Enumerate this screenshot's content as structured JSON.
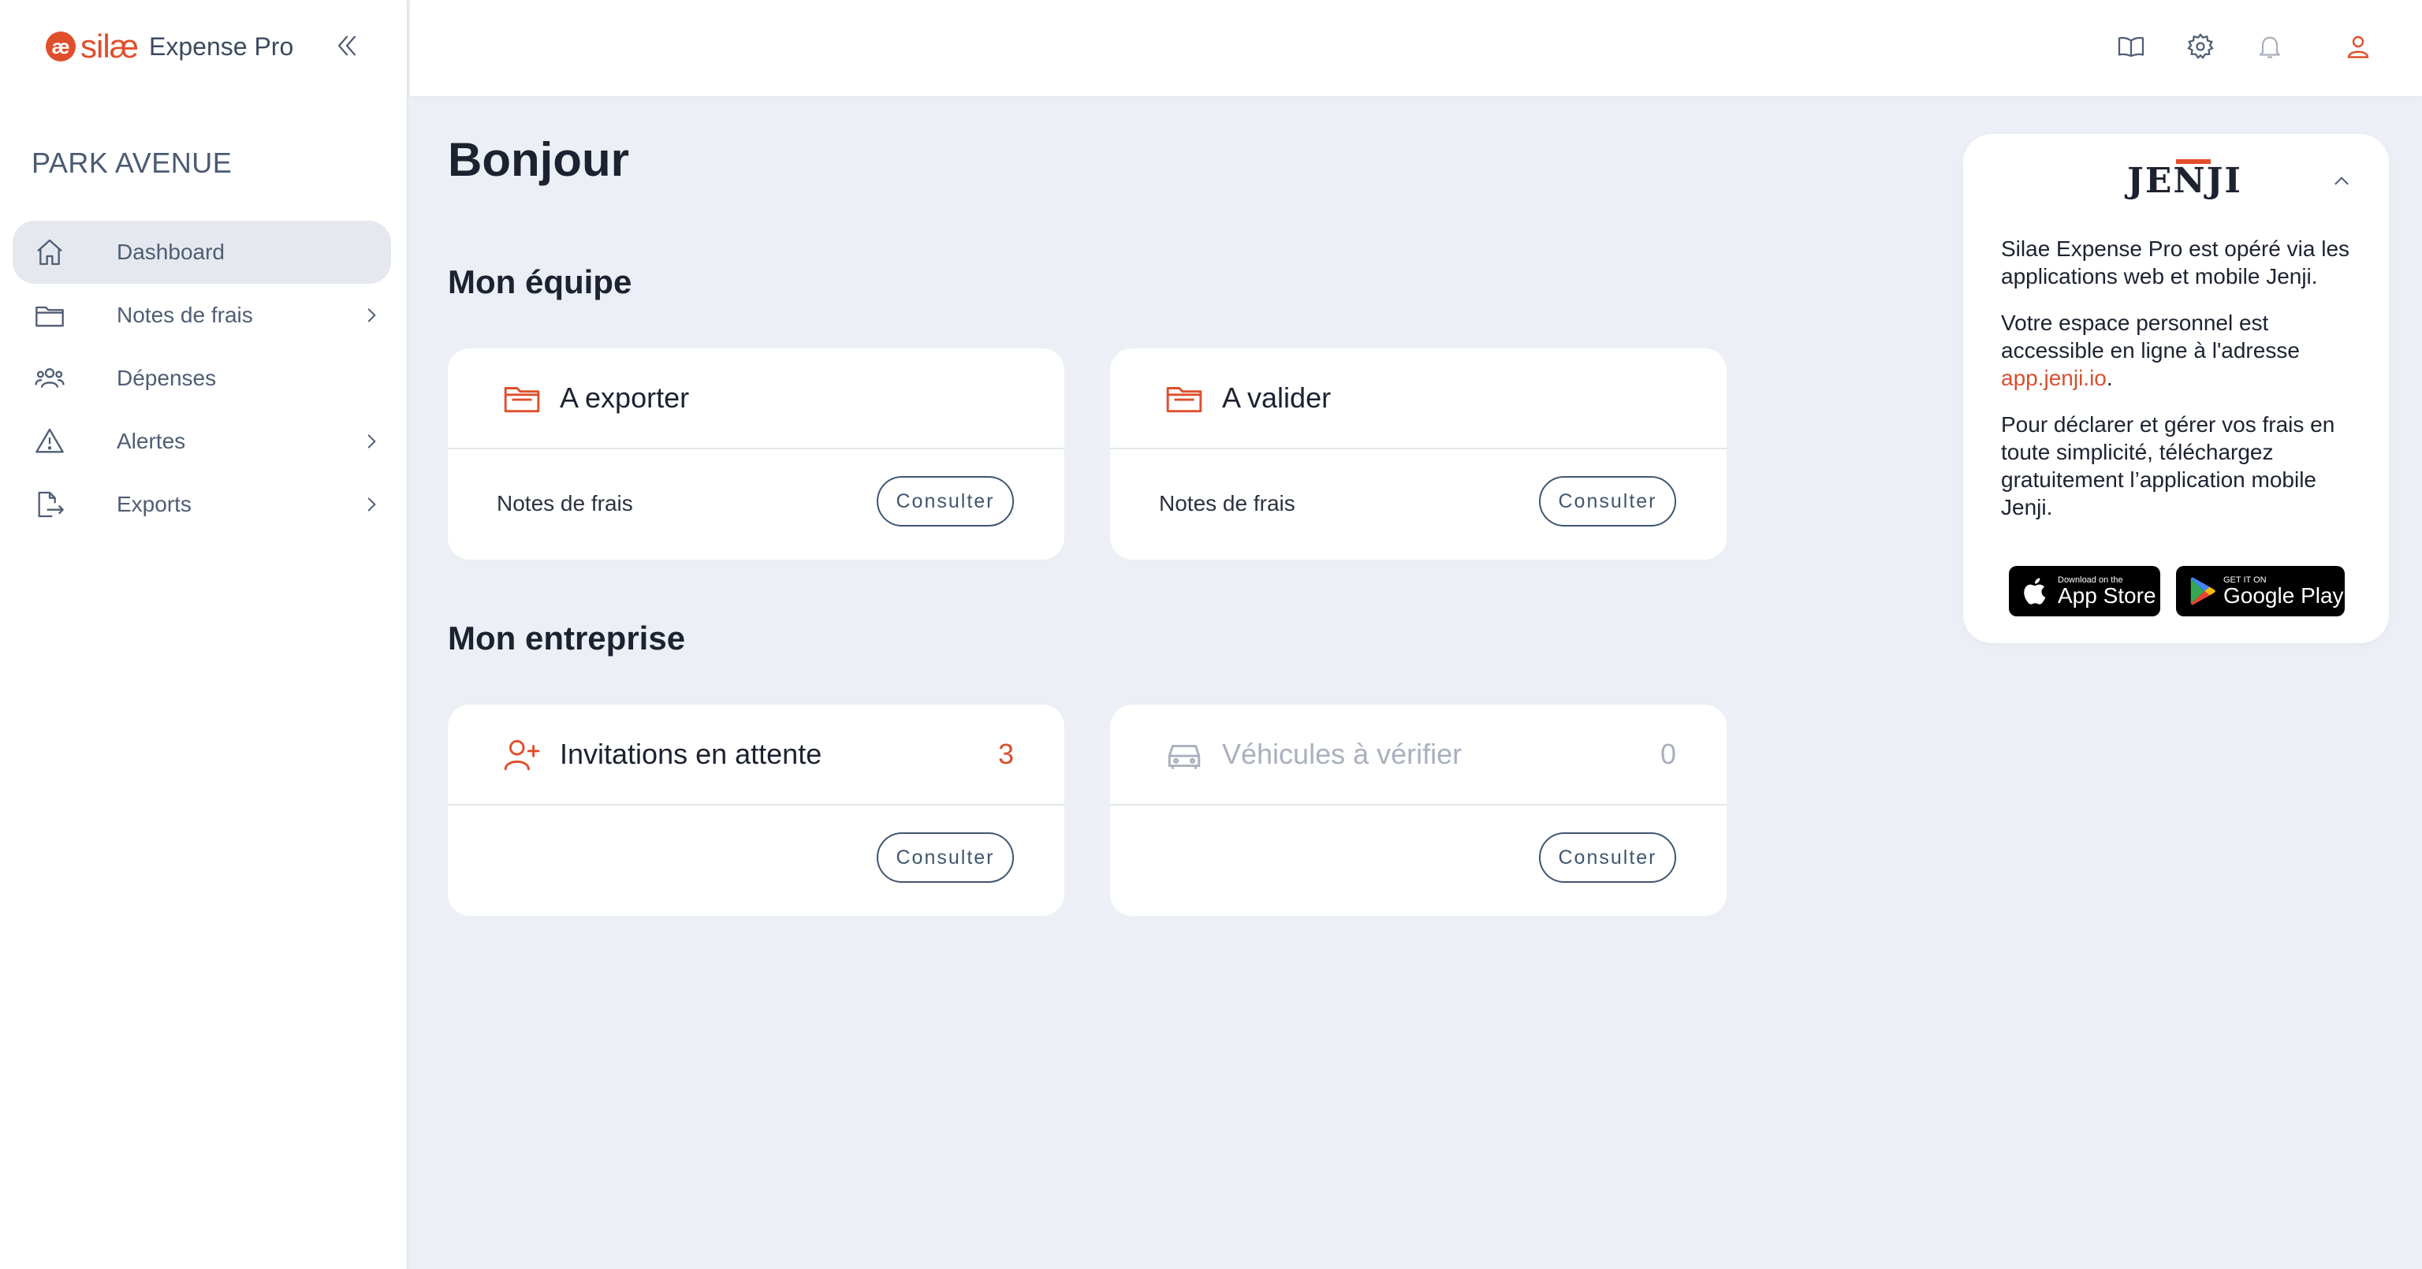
{
  "brand": {
    "mark": "æ",
    "name": "silæ",
    "product": "Expense Pro"
  },
  "company": "PARK AVENUE",
  "sidebar": {
    "items": [
      {
        "label": "Dashboard",
        "icon": "home-icon",
        "active": true,
        "chevron": false
      },
      {
        "label": "Notes de frais",
        "icon": "folder-icon",
        "active": false,
        "chevron": true
      },
      {
        "label": "Dépenses",
        "icon": "users-icon",
        "active": false,
        "chevron": false
      },
      {
        "label": "Alertes",
        "icon": "warning-icon",
        "active": false,
        "chevron": true
      },
      {
        "label": "Exports",
        "icon": "export-icon",
        "active": false,
        "chevron": true
      }
    ]
  },
  "topbar": {
    "icons": [
      "book-icon",
      "gear-icon",
      "bell-icon",
      "user-icon"
    ]
  },
  "greeting": "Bonjour",
  "sections": {
    "team": {
      "title": "Mon équipe",
      "cards": [
        {
          "title": "A exporter",
          "body": "Notes de frais",
          "button": "Consulter"
        },
        {
          "title": "A valider",
          "body": "Notes de frais",
          "button": "Consulter"
        }
      ]
    },
    "company": {
      "title": "Mon entreprise",
      "cards": [
        {
          "title": "Invitations en attente",
          "count": "3",
          "button": "Consulter"
        },
        {
          "title": "Véhicules à vérifier",
          "count": "0",
          "button": "Consulter"
        }
      ]
    }
  },
  "jenji": {
    "logo": "JENJI",
    "p1": "Silae Expense Pro est opéré via les applications web et mobile Jenji.",
    "p2_before": "Votre espace personnel est accessible en ligne à l'adresse ",
    "p2_link": "app.jenji.io",
    "p2_after": ".",
    "p3": "Pour déclarer et gérer vos frais en toute simplicité, téléchargez gratuitement l’application mobile Jenji.",
    "appstore_small": "Download on the",
    "appstore_big": "App Store",
    "googleplay_small": "GET IT ON",
    "googleplay_big": "Google Play"
  },
  "colors": {
    "accent": "#e04e2c",
    "navy": "#3f5670",
    "background": "#eceff6"
  }
}
